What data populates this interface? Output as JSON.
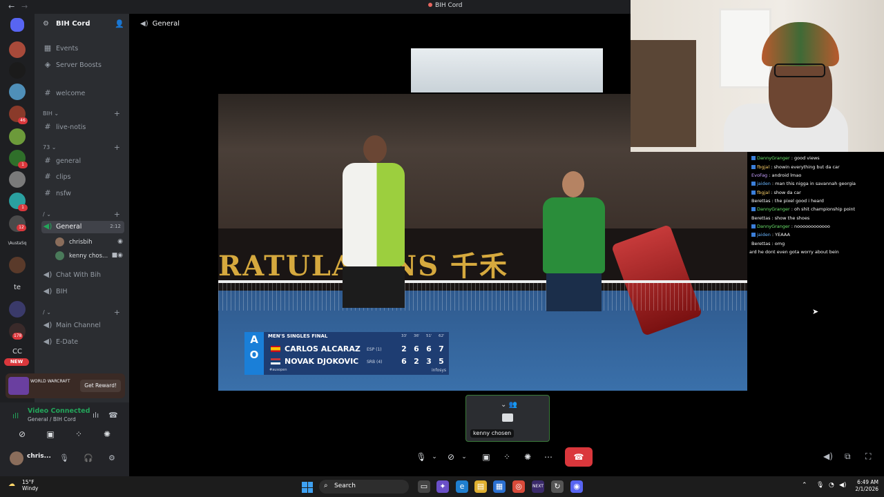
{
  "window": {
    "title": "BIH Cord",
    "back": "←",
    "forward": "→"
  },
  "rail": {
    "badges": [
      "46",
      "1",
      "1",
      "12",
      "178"
    ],
    "text_items": [
      "\\AustaSq",
      "te",
      "CC"
    ],
    "new_pill": "NEW"
  },
  "server": {
    "name": "BIH Cord"
  },
  "sidebar": {
    "events": "Events",
    "boosts": "Server Boosts",
    "welcome": "welcome",
    "cat_bih": "BIH",
    "live_notis": "live-notis",
    "cat_73": "73",
    "general_text": "general",
    "clips": "clips",
    "nsfw": "nsfw",
    "cat_slash": "/",
    "voice_general": "General",
    "voice_general_time": "2:12",
    "members": [
      {
        "name": "chrisbih"
      },
      {
        "name": "kenny chos..."
      }
    ],
    "chat_with_bih": "Chat With Bih",
    "bih_voice": "BIH",
    "cat_slash2": "/",
    "main_channel": "Main Channel",
    "edate": "E-Date"
  },
  "promo": {
    "logo_text": "WORLD WARCRAFT",
    "button": "Get Reward!"
  },
  "voice_panel": {
    "status": "Video Connected",
    "location": "General / BIH Cord"
  },
  "user": {
    "name": "chris..."
  },
  "main": {
    "channel": "General"
  },
  "scoreboard": {
    "title": "MEN'S SINGLES FINAL",
    "set_times": [
      "33'",
      "36'",
      "51'",
      "62'"
    ],
    "players": [
      {
        "name": "CARLOS ALCARAZ",
        "seed": "ESP (1)",
        "scores": [
          "2",
          "6",
          "6",
          "7"
        ]
      },
      {
        "name": "NOVAK DJOKOVIC",
        "seed": "SRB (4)",
        "scores": [
          "6",
          "2",
          "3",
          "5"
        ]
      }
    ],
    "hashtag": "#ausopen",
    "sponsor": "infosys",
    "banner": "RATULA   ONS  千禾"
  },
  "chat": [
    {
      "user": "DannyGranger",
      "msg": "good views"
    },
    {
      "user": "fbgjal",
      "msg": "showin everything but da car"
    },
    {
      "user": "EvoFag",
      "msg": "android lmao"
    },
    {
      "user": "jaiden",
      "msg": "man this nigga in savannah georgia"
    },
    {
      "user": "fbgjal",
      "msg": "show da car"
    },
    {
      "user": "Berettas",
      "msg": "the pixel good i heard"
    },
    {
      "user": "DannyGranger",
      "msg": "oh shit championship point"
    },
    {
      "user": "Berettas",
      "msg": "show the shoes"
    },
    {
      "user": "DannyGranger",
      "msg": "noooooooooooo"
    },
    {
      "user": "jaiden",
      "msg": "YEAAA"
    },
    {
      "user": "Berettas",
      "msg": "omg"
    },
    {
      "user": "",
      "msg": "ard he dont even gota worry about bein"
    }
  ],
  "self_tile": {
    "name": "kenny chosen"
  },
  "taskbar": {
    "temp": "15°F",
    "weather": "Windy",
    "search": "Search",
    "time": "6:49 AM",
    "date": "2/1/2026"
  },
  "colors": {
    "accent_green": "#23a55a",
    "danger": "#da373c",
    "sidebar": "#2b2d31",
    "rail": "#1e1f22"
  }
}
